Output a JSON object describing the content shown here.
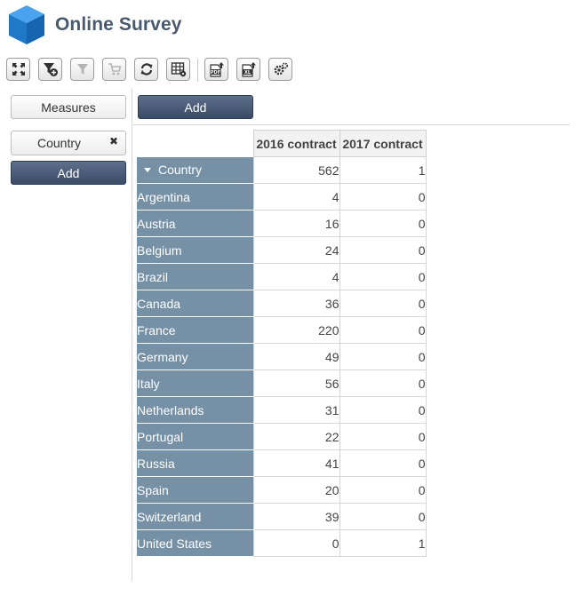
{
  "app": {
    "title": "Online Survey"
  },
  "toolbar": {
    "buttons": [
      {
        "name": "fullscreen-icon"
      },
      {
        "name": "add-filter-icon"
      },
      {
        "name": "filter-icon"
      },
      {
        "name": "cart-icon"
      },
      {
        "name": "refresh-icon"
      },
      {
        "name": "table-settings-icon"
      },
      {
        "name": "export-pdf-icon"
      },
      {
        "name": "export-excel-icon"
      },
      {
        "name": "settings-icon"
      }
    ]
  },
  "left_panel": {
    "measures_label": "Measures",
    "dimension_chip": {
      "label": "Country",
      "close_symbol": "✖"
    },
    "add_label": "Add"
  },
  "main": {
    "add_label": "Add",
    "pivot": {
      "columns": [
        "2016 contract",
        "2017 contract"
      ],
      "total": {
        "label": "Country",
        "values": [
          562,
          1
        ]
      },
      "rows": [
        {
          "label": "Argentina",
          "values": [
            4,
            0
          ]
        },
        {
          "label": "Austria",
          "values": [
            16,
            0
          ]
        },
        {
          "label": "Belgium",
          "values": [
            24,
            0
          ]
        },
        {
          "label": "Brazil",
          "values": [
            4,
            0
          ]
        },
        {
          "label": "Canada",
          "values": [
            36,
            0
          ]
        },
        {
          "label": "France",
          "values": [
            220,
            0
          ]
        },
        {
          "label": "Germany",
          "values": [
            49,
            0
          ]
        },
        {
          "label": "Italy",
          "values": [
            56,
            0
          ]
        },
        {
          "label": "Netherlands",
          "values": [
            31,
            0
          ]
        },
        {
          "label": "Portugal",
          "values": [
            22,
            0
          ]
        },
        {
          "label": "Russia",
          "values": [
            41,
            0
          ]
        },
        {
          "label": "Spain",
          "values": [
            20,
            0
          ]
        },
        {
          "label": "Switzerland",
          "values": [
            39,
            0
          ]
        },
        {
          "label": "United States",
          "values": [
            0,
            1
          ]
        }
      ]
    }
  },
  "colors": {
    "brand_blue": "#1f78c8",
    "header_row_bg": "#7690a6",
    "dark_button": "#3a4b66",
    "title_text": "#4a5a6e"
  }
}
